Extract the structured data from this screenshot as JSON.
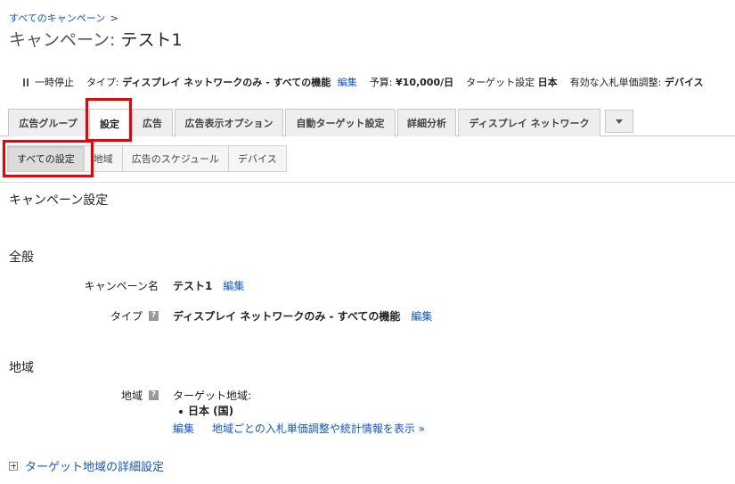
{
  "breadcrumb": {
    "link": "すべてのキャンペーン",
    "sep": ">"
  },
  "page_title": {
    "prefix": "キャンペーン:",
    "name": "テスト1"
  },
  "status": {
    "pause": "一時停止",
    "type_label": "タイプ:",
    "type_value": "ディスプレイ ネットワークのみ - すべての機能",
    "edit": "編集",
    "budget_label": "予算:",
    "budget_value": "¥10,000/日",
    "target_label": "ターゲット設定",
    "target_value": "日本",
    "bid_label": "有効な入札単価調整:",
    "bid_value": "デバイス"
  },
  "tabs": [
    "広告グループ",
    "設定",
    "広告",
    "広告表示オプション",
    "自動ターゲット設定",
    "詳細分析",
    "ディスプレイ ネットワーク"
  ],
  "subtabs": [
    "すべての設定",
    "地域",
    "広告のスケジュール",
    "デバイス"
  ],
  "content": {
    "heading": "キャンペーン設定",
    "general": {
      "title": "全般",
      "name_label": "キャンペーン名",
      "name_value": "テスト1",
      "name_edit": "編集",
      "type_label": "タイプ",
      "type_value": "ディスプレイ ネットワークのみ - すべての機能",
      "type_edit": "編集"
    },
    "region": {
      "title": "地域",
      "label": "地域",
      "target_heading": "ターゲット地域:",
      "items": [
        "日本 (国)"
      ],
      "edit": "編集",
      "stats_link": "地域ごとの入札単価調整や統計情報を表示 »"
    },
    "advanced_link": "ターゲット地域の詳細設定"
  },
  "colors": {
    "link": "#1155cc",
    "highlight": "#ee0000"
  },
  "icons": {
    "help": "?"
  }
}
